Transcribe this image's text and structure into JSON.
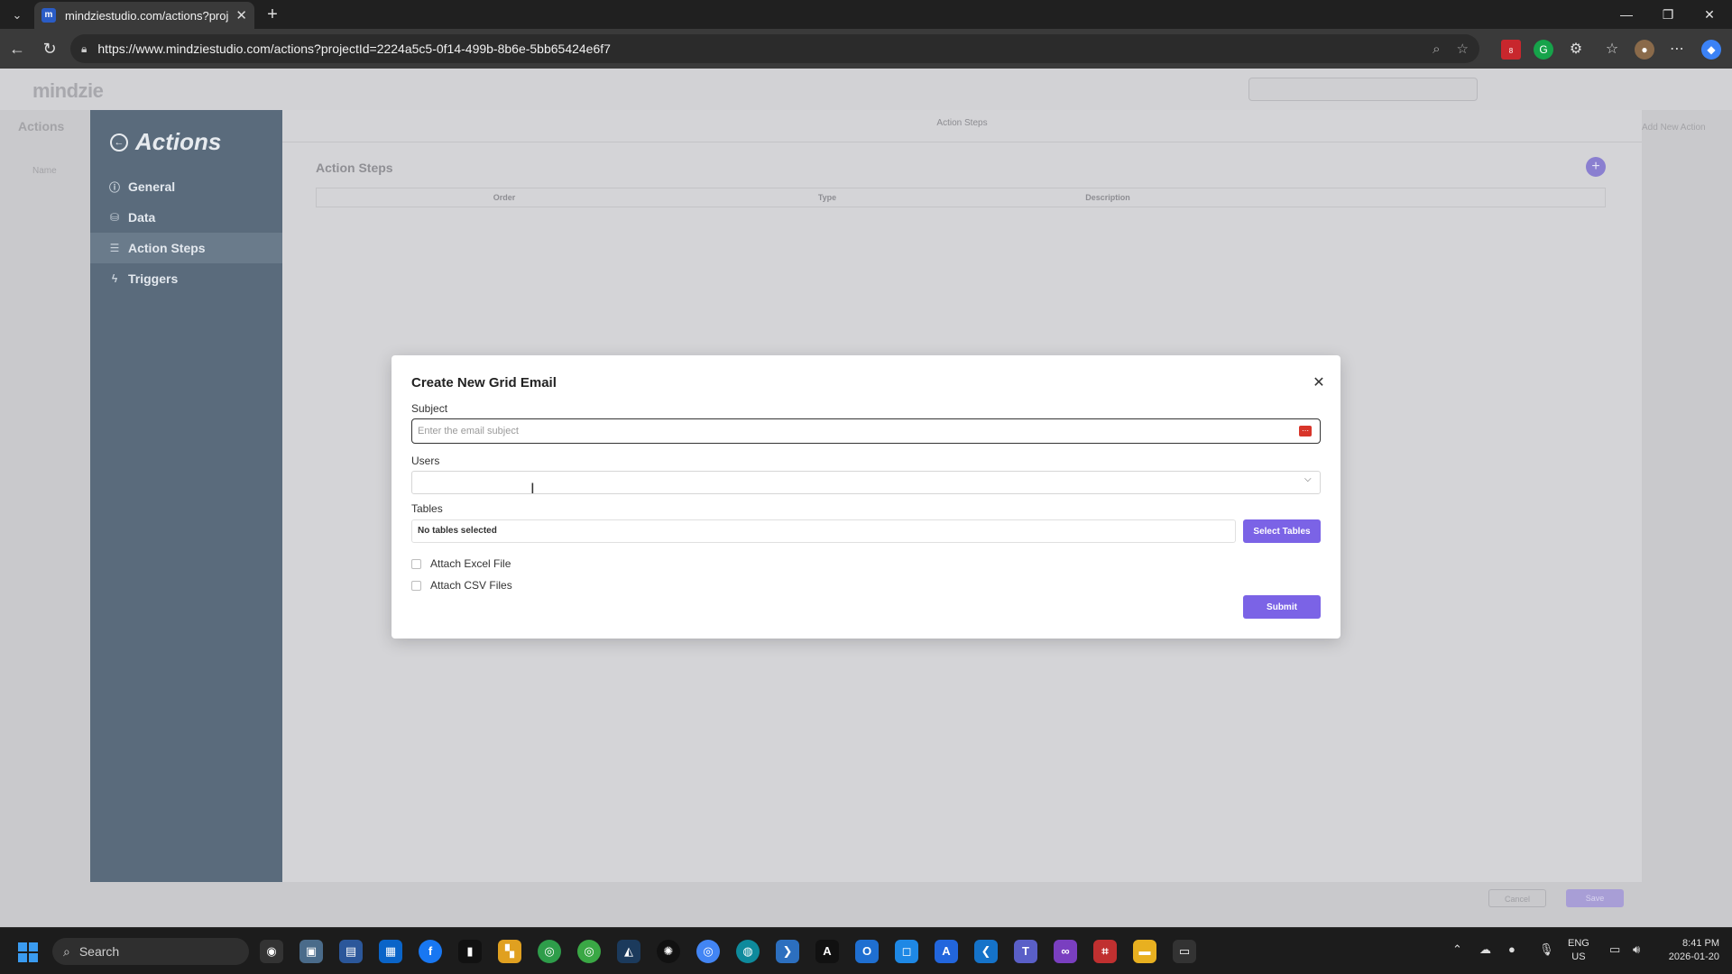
{
  "browser": {
    "tab_title": "mindziestudio.com/actions?proje",
    "favicon_letter": "m",
    "url": "https://www.mindziestudio.com/actions?projectId=2224a5c5-0f14-499b-8b6e-5bb65424e6f7",
    "extension_badge": "8"
  },
  "app": {
    "logo": "mindzie",
    "bg_page_title": "Actions",
    "bg_name_header": "Name",
    "bg_add_link": "Add New Action"
  },
  "panel": {
    "title": "Actions",
    "header": "Action Steps",
    "section_title": "Action Steps",
    "sidebar": [
      {
        "label": "General",
        "icon": "info-icon"
      },
      {
        "label": "Data",
        "icon": "database-icon"
      },
      {
        "label": "Action Steps",
        "icon": "steps-icon"
      },
      {
        "label": "Triggers",
        "icon": "bolt-icon"
      }
    ],
    "grid_columns": [
      "Order",
      "Type",
      "Description"
    ],
    "cancel_label": "Cancel",
    "save_label": "Save"
  },
  "modal": {
    "title": "Create New Grid Email",
    "subject_label": "Subject",
    "subject_placeholder": "Enter the email subject",
    "subject_value": "",
    "users_label": "Users",
    "tables_label": "Tables",
    "tables_value": "No tables selected",
    "select_tables_label": "Select Tables",
    "attach_excel_label": "Attach Excel File",
    "attach_csv_label": "Attach CSV Files",
    "submit_label": "Submit",
    "accent_color": "#7b63e6"
  },
  "taskbar": {
    "search_placeholder": "Search",
    "lang_line1": "ENG",
    "lang_line2": "US",
    "time": "8:41 PM",
    "date": "2026-01-20"
  }
}
